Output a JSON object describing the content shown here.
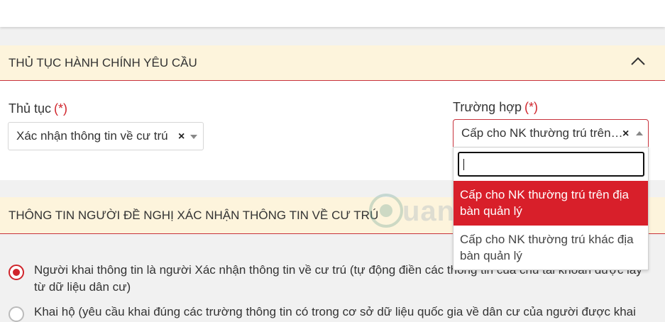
{
  "section_admin": {
    "title": "THỦ TỤC HÀNH CHÍNH YÊU CẦU"
  },
  "procedure": {
    "label": "Thủ tục",
    "required_mark": "(*)",
    "value": "Xác nhận thông tin về cư trú",
    "clear": "×"
  },
  "case": {
    "label": "Trường hợp",
    "required_mark": "(*)",
    "value": "Cấp cho NK thường trú trên …",
    "clear": "×",
    "search_value": "",
    "options": [
      {
        "label": "Cấp cho NK thường trú trên địa bàn quản lý",
        "selected": true
      },
      {
        "label": "Cấp cho NK thường trú khác địa bàn quản lý",
        "selected": false
      }
    ]
  },
  "section_requester": {
    "title": "THÔNG TIN NGƯỜI ĐỀ NGHỊ XÁC NHẬN THÔNG TIN VỀ CƯ TRÚ"
  },
  "declarant_options": [
    {
      "label": "Người khai thông tin là người Xác nhận thông tin về cư trú (tự động điền các thông tin của chủ tài khoản được lấy từ dữ liệu dân cư)",
      "checked": true
    },
    {
      "label": "Khai hộ (yêu cầu khai đúng các trường thông tin có trong cơ sở dữ liệu quốc gia về dân cư của người được khai",
      "checked": false
    }
  ],
  "watermark": {
    "text": "uantrimang"
  },
  "colors": {
    "accent": "#d0252c",
    "header_bg": "#fdf4dc",
    "selected_option": "#d81f2a"
  }
}
